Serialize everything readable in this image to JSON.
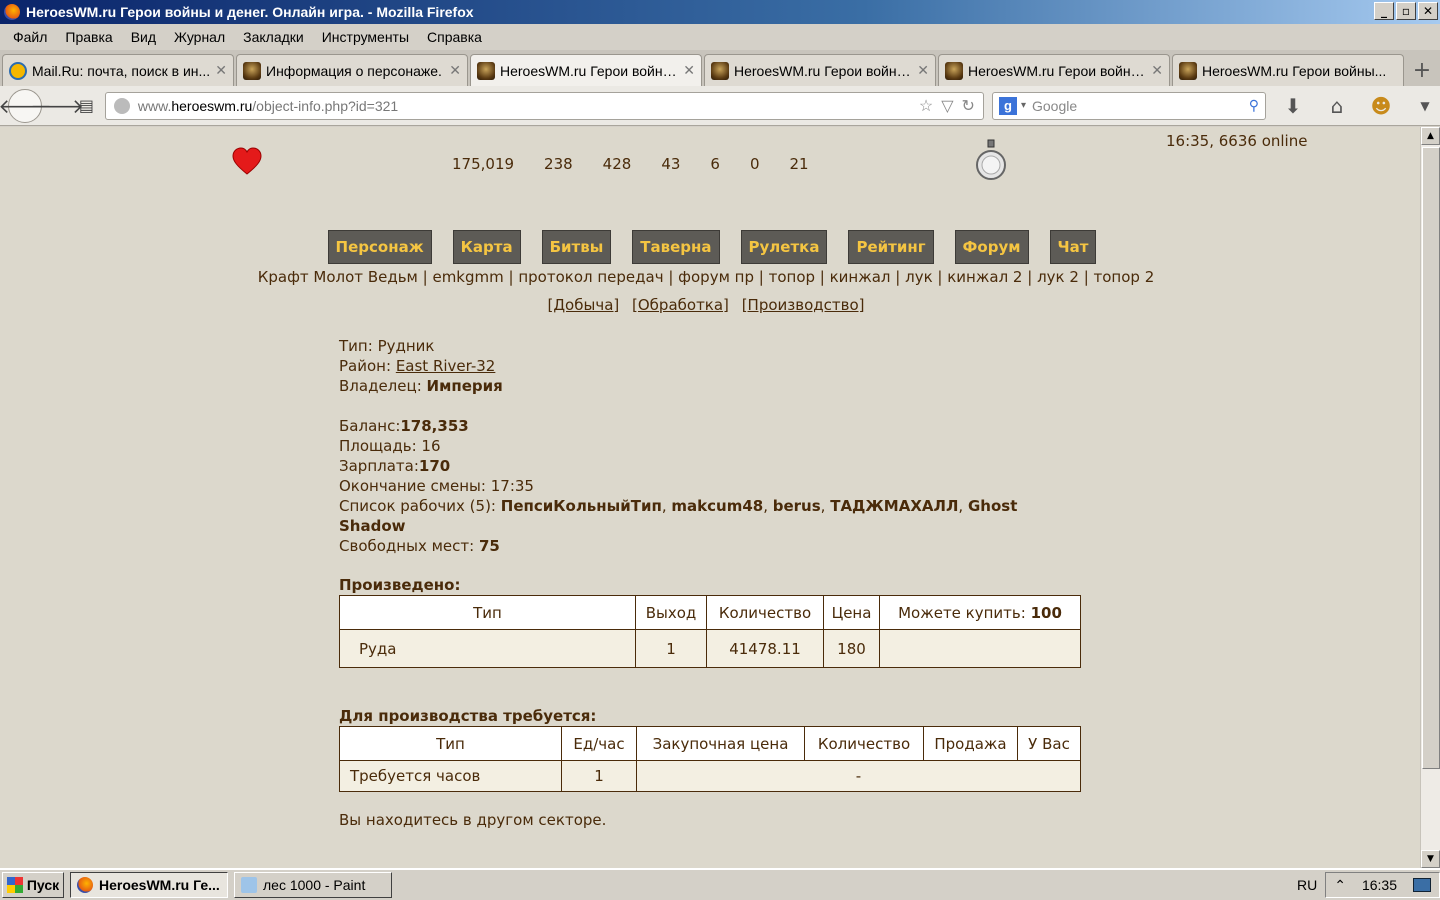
{
  "window": {
    "title": "HeroesWM.ru Герои войны и денег. Онлайн игра. - Mozilla Firefox",
    "controls": [
      "_",
      "▫",
      "✕"
    ]
  },
  "menubar": [
    "Файл",
    "Правка",
    "Вид",
    "Журнал",
    "Закладки",
    "Инструменты",
    "Справка"
  ],
  "tabs": [
    {
      "label": "Mail.Ru: почта, поиск в ин...",
      "icon": "mail-icon",
      "active": false
    },
    {
      "label": "Информация о персонаже.",
      "icon": "hwm-icon",
      "active": false
    },
    {
      "label": "HeroesWM.ru Герои войны...",
      "icon": "hwm-icon",
      "active": true
    },
    {
      "label": "HeroesWM.ru Герои войны...",
      "icon": "hwm-icon",
      "active": false
    },
    {
      "label": "HeroesWM.ru Герои войны...",
      "icon": "hwm-icon",
      "active": false
    },
    {
      "label": "HeroesWM.ru Герои войны...",
      "icon": "hwm-icon",
      "active": false
    }
  ],
  "navbar": {
    "url_prefix": "www.",
    "url_host": "heroeswm.ru",
    "url_path": "/object-info.php?id=321",
    "search_placeholder": "Google"
  },
  "header": {
    "stats": [
      "175,019",
      "238",
      "428",
      "43",
      "6",
      "0",
      "21"
    ],
    "clock": "16:35, 6636 online"
  },
  "main_nav": [
    "Персонаж",
    "Карта",
    "Битвы",
    "Таверна",
    "Рулетка",
    "Рейтинг",
    "Форум",
    "Чат"
  ],
  "links_row": [
    "Крафт Молот Ведьм",
    "emkgmm",
    "протокол передач",
    "форум пр",
    "топор",
    "кинжал",
    "лук",
    "кинжал 2",
    "лук 2",
    "топор 2"
  ],
  "sub_links": [
    "[Добыча]",
    "[Обработка]",
    "[Производство]"
  ],
  "object": {
    "type_label": "Тип:",
    "type_value": "Рудник",
    "district_label": "Район:",
    "district_value": "East River-32",
    "owner_label": "Владелец:",
    "owner_value": "Империя",
    "balance_label": "Баланс:",
    "balance_value": "178,353",
    "area_label": "Площадь:",
    "area_value": "16",
    "salary_label": "Зарплата:",
    "salary_value": "170",
    "shift_end_label": "Окончание смены:",
    "shift_end_value": "17:35",
    "workers_label": "Список рабочих (5):",
    "workers": [
      "ПепсиКольныйТип",
      "makcum48",
      "berus",
      "ТАДЖМАХАЛЛ",
      "Ghost Shadow"
    ],
    "free_label": "Свободных мест:",
    "free_value": "75"
  },
  "produced": {
    "title": "Произведено:",
    "headers": [
      "Тип",
      "Выход",
      "Количество",
      "Цена",
      "Можете купить:"
    ],
    "can_buy_value": "100",
    "rows": [
      [
        "Руда",
        "1",
        "41478.11",
        "180",
        ""
      ]
    ]
  },
  "required": {
    "title": "Для производства требуется:",
    "headers": [
      "Тип",
      "Ед/час",
      "Закупочная цена",
      "Количество",
      "Продажа",
      "У Вас"
    ],
    "rows": [
      [
        "Требуется часов",
        "1",
        "-"
      ]
    ]
  },
  "note": "Вы находитесь в другом секторе.",
  "taskbar": {
    "start": "Пуск",
    "items": [
      {
        "label": "HeroesWM.ru Ге...",
        "active": true
      },
      {
        "label": "лес 1000 - Paint",
        "active": false
      }
    ],
    "lang": "RU",
    "time": "16:35"
  },
  "colors": {
    "content_bg": "#dcd8cc",
    "text_brown": "#4a2b0a",
    "nav_button_bg": "#5d5b56",
    "nav_button_text": "#f5c542"
  }
}
